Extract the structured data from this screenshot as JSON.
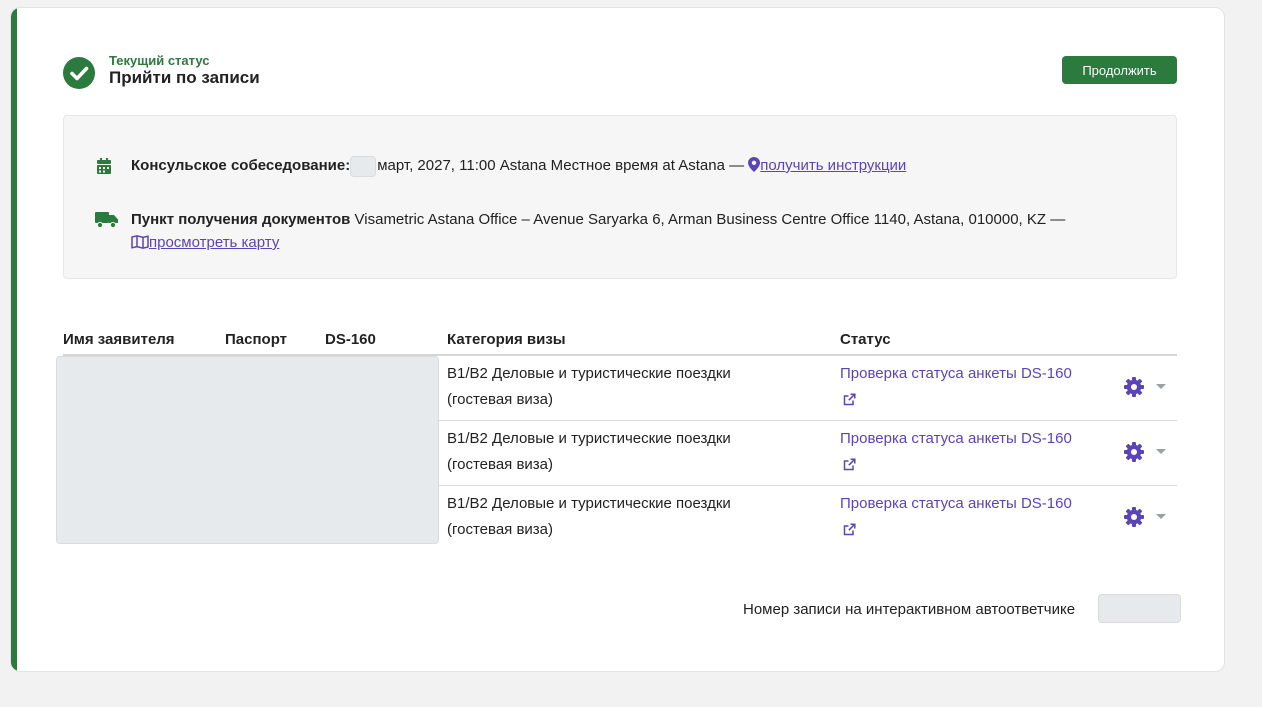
{
  "status": {
    "label": "Текущий статус",
    "value": "Прийти по записи",
    "continue_label": "Продолжить"
  },
  "interview": {
    "label": "Консульское собеседование:",
    "date_text": "март, 2027, 11:00 Astana Местное время at Astana —",
    "link": "получить инструкции"
  },
  "pickup": {
    "label": "Пункт получения документов",
    "address": "Visametric Astana Office – Avenue Saryarka 6, Arman Business Centre Office 1140, Astana, 010000, KZ —",
    "link": "просмотреть карту"
  },
  "table": {
    "headers": {
      "applicant": "Имя заявителя",
      "passport": "Паспорт",
      "ds160": "DS-160",
      "category": "Категория визы",
      "status": "Статус"
    },
    "rows": [
      {
        "category": "B1/B2 Деловые и туристические поездки (гостевая виза)",
        "status": "Проверка статуса анкеты DS-160"
      },
      {
        "category": "B1/B2 Деловые и туристические поездки (гостевая виза)",
        "status": "Проверка статуса анкеты DS-160"
      },
      {
        "category": "B1/B2 Деловые и туристические поездки (гостевая виза)",
        "status": "Проверка статуса анкеты DS-160"
      }
    ]
  },
  "ivr": {
    "label": "Номер записи на интерактивном автоответчике"
  },
  "colors": {
    "accent_green": "#2b7a3e",
    "link_purple": "#5b44b8"
  },
  "icons": [
    "check-circle-icon",
    "calendar-icon",
    "truck-icon",
    "map-pin-icon",
    "map-icon",
    "external-link-icon",
    "gear-icon",
    "caret-down-icon"
  ]
}
